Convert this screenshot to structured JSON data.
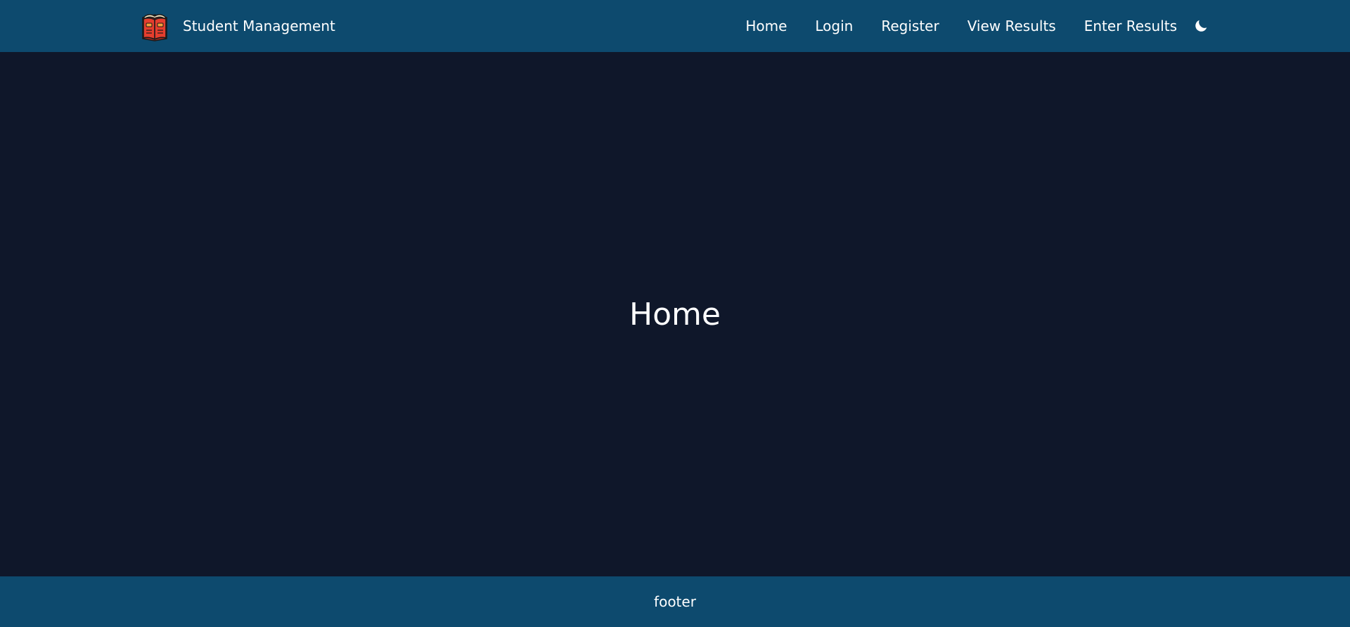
{
  "navbar": {
    "brand_name": "Student Management",
    "brand_icon": "book-icon",
    "links": [
      {
        "label": "Home"
      },
      {
        "label": "Login"
      },
      {
        "label": "Register"
      },
      {
        "label": "View Results"
      },
      {
        "label": "Enter Results"
      }
    ],
    "theme_toggle_icon": "moon-icon"
  },
  "main": {
    "title": "Home"
  },
  "footer": {
    "text": "footer"
  },
  "colors": {
    "navbar_bg": "#0d4a6e",
    "page_bg": "#0f172a",
    "text": "#ffffff",
    "logo_red": "#e53e2e"
  }
}
